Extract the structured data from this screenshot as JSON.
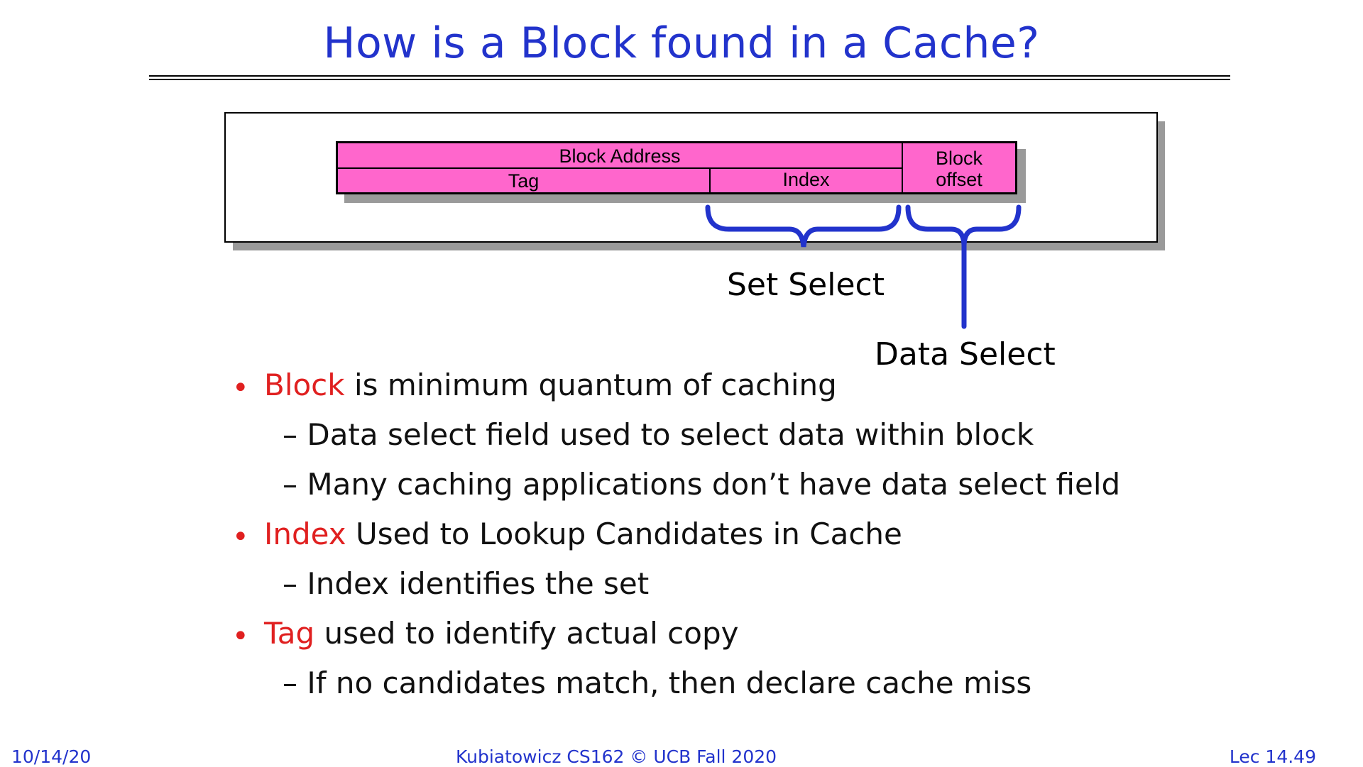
{
  "slide": {
    "title": "How is a Block found in a Cache?"
  },
  "diagram": {
    "block_address_label": "Block Address",
    "tag_label": "Tag",
    "index_label": "Index",
    "block_offset_line1": "Block",
    "block_offset_line2": "offset",
    "set_select_label": "Set Select",
    "data_select_label": "Data Select",
    "field_color": "#ff66cc",
    "bracket_color": "#2233cc"
  },
  "bullets": [
    {
      "highlight": "Block",
      "text": " is minimum quantum of caching",
      "subs": [
        "– Data select field used to select data within block",
        "– Many caching applications don’t have data select field"
      ]
    },
    {
      "highlight": "Index",
      "text": " Used to Lookup Candidates in Cache",
      "subs": [
        "– Index identifies the set"
      ]
    },
    {
      "highlight": "Tag",
      "text": " used to identify actual copy",
      "subs": [
        "– If no candidates match, then declare cache miss"
      ]
    }
  ],
  "footer": {
    "date": "10/14/20",
    "course": "Kubiatowicz CS162 © UCB Fall 2020",
    "lecture": "Lec 14.49"
  }
}
